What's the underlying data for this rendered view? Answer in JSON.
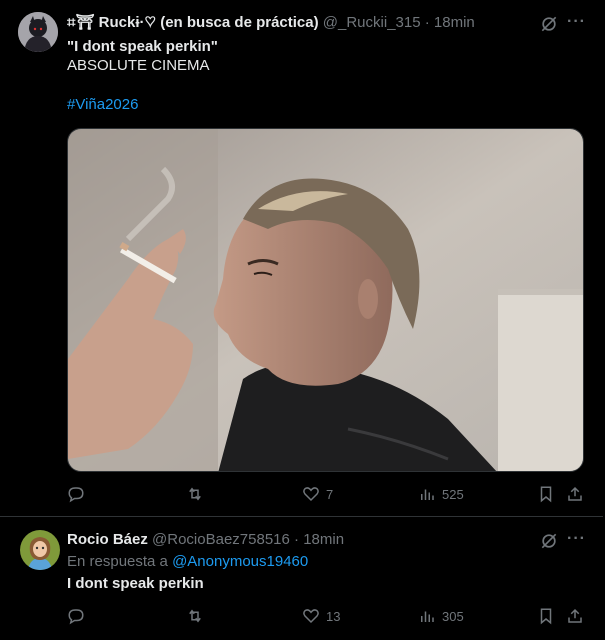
{
  "tweet1": {
    "display_name": "⌗⛩ Ruckɨ·♡ (en busca de práctica)",
    "handle": "@_Ruckii_315",
    "separator": "·",
    "time": "18min",
    "text_line1": "\"I dont speak perkin\"",
    "text_line2": "ABSOLUTE CINEMA",
    "hashtag": "#Viña2026",
    "replies": "",
    "retweets": "",
    "likes": "7",
    "views": "525"
  },
  "tweet2": {
    "display_name": "Rocio Báez",
    "handle": "@RocioBaez758516",
    "separator": "·",
    "time": "18min",
    "reply_prefix": "En respuesta a",
    "reply_to": "@Anonymous19460",
    "text": "I dont speak perkin",
    "replies": "",
    "retweets": "",
    "likes": "13",
    "views": "305"
  },
  "ui": {
    "more_glyph": "···"
  },
  "colors": {
    "background": "#000000",
    "text": "#e7e9ea",
    "muted": "#71767b",
    "link": "#1d9bf0",
    "border": "#2f3336"
  }
}
